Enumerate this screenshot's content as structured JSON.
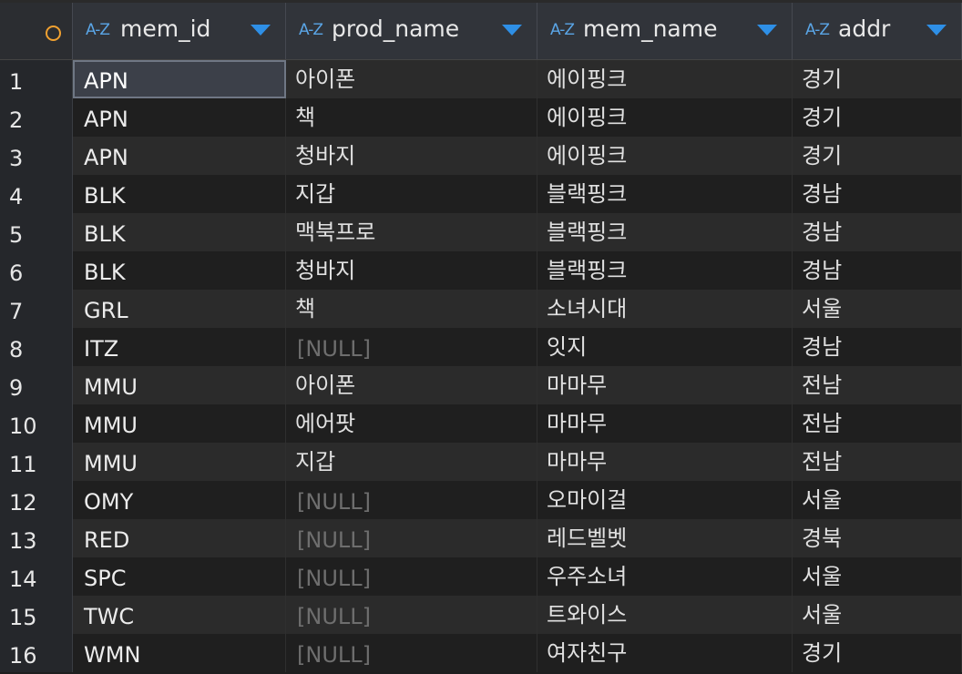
{
  "columns": [
    {
      "type_icon": "A-Z",
      "name": "mem_id"
    },
    {
      "type_icon": "A-Z",
      "name": "prod_name"
    },
    {
      "type_icon": "A-Z",
      "name": "mem_name"
    },
    {
      "type_icon": "A-Z",
      "name": "addr"
    }
  ],
  "rows": [
    {
      "num": "1",
      "mem_id": "APN",
      "prod_name": "아이폰",
      "mem_name": "에이핑크",
      "addr": "경기"
    },
    {
      "num": "2",
      "mem_id": "APN",
      "prod_name": "책",
      "mem_name": "에이핑크",
      "addr": "경기"
    },
    {
      "num": "3",
      "mem_id": "APN",
      "prod_name": "청바지",
      "mem_name": "에이핑크",
      "addr": "경기"
    },
    {
      "num": "4",
      "mem_id": "BLK",
      "prod_name": "지갑",
      "mem_name": "블랙핑크",
      "addr": "경남"
    },
    {
      "num": "5",
      "mem_id": "BLK",
      "prod_name": "맥북프로",
      "mem_name": "블랙핑크",
      "addr": "경남"
    },
    {
      "num": "6",
      "mem_id": "BLK",
      "prod_name": "청바지",
      "mem_name": "블랙핑크",
      "addr": "경남"
    },
    {
      "num": "7",
      "mem_id": "GRL",
      "prod_name": "책",
      "mem_name": "소녀시대",
      "addr": "서울"
    },
    {
      "num": "8",
      "mem_id": "ITZ",
      "prod_name": "[NULL]",
      "mem_name": "잇지",
      "addr": "경남"
    },
    {
      "num": "9",
      "mem_id": "MMU",
      "prod_name": "아이폰",
      "mem_name": "마마무",
      "addr": "전남"
    },
    {
      "num": "10",
      "mem_id": "MMU",
      "prod_name": "에어팟",
      "mem_name": "마마무",
      "addr": "전남"
    },
    {
      "num": "11",
      "mem_id": "MMU",
      "prod_name": "지갑",
      "mem_name": "마마무",
      "addr": "전남"
    },
    {
      "num": "12",
      "mem_id": "OMY",
      "prod_name": "[NULL]",
      "mem_name": "오마이걸",
      "addr": "서울"
    },
    {
      "num": "13",
      "mem_id": "RED",
      "prod_name": "[NULL]",
      "mem_name": "레드벨벳",
      "addr": "경북"
    },
    {
      "num": "14",
      "mem_id": "SPC",
      "prod_name": "[NULL]",
      "mem_name": "우주소녀",
      "addr": "서울"
    },
    {
      "num": "15",
      "mem_id": "TWC",
      "prod_name": "[NULL]",
      "mem_name": "트와이스",
      "addr": "서울"
    },
    {
      "num": "16",
      "mem_id": "WMN",
      "prod_name": "[NULL]",
      "mem_name": "여자친구",
      "addr": "경기"
    }
  ],
  "colors": {
    "select_all_circle": "#f0a030",
    "type_icon": "#5aa5e6",
    "sort_caret": "#2e8fe6",
    "null_text": "#6e6e6e"
  },
  "icons": {
    "select_all": "circle-icon",
    "column_type": "text-type-icon",
    "column_menu": "caret-down-icon"
  }
}
